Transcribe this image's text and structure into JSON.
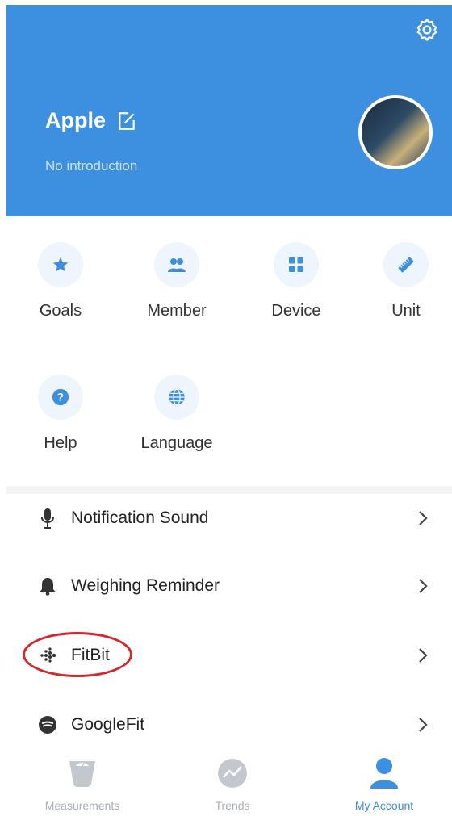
{
  "header": {
    "name": "Apple",
    "introduction": "No introduction",
    "icons": {
      "settings": "gear-icon",
      "edit": "edit-icon"
    }
  },
  "grid": [
    {
      "label": "Goals",
      "icon": "star-icon"
    },
    {
      "label": "Member",
      "icon": "members-icon"
    },
    {
      "label": "Device",
      "icon": "device-grid-icon"
    },
    {
      "label": "Unit",
      "icon": "ruler-icon"
    },
    {
      "label": "Help",
      "icon": "help-icon"
    },
    {
      "label": "Language",
      "icon": "globe-icon"
    }
  ],
  "list": [
    {
      "label": "Notification Sound",
      "icon": "microphone-icon"
    },
    {
      "label": "Weighing Reminder",
      "icon": "bell-icon"
    },
    {
      "label": "FitBit",
      "icon": "fitbit-icon"
    },
    {
      "label": "GoogleFit",
      "icon": "googlefit-icon"
    }
  ],
  "tabs": [
    {
      "label": "Measurements",
      "icon": "scale-icon",
      "active": false
    },
    {
      "label": "Trends",
      "icon": "trends-icon",
      "active": false
    },
    {
      "label": "My Account",
      "icon": "person-icon",
      "active": true
    }
  ],
  "colors": {
    "primary": "#3d8fe0",
    "highlight_ring": "#d6252b",
    "inactive": "#a9b0b8"
  }
}
